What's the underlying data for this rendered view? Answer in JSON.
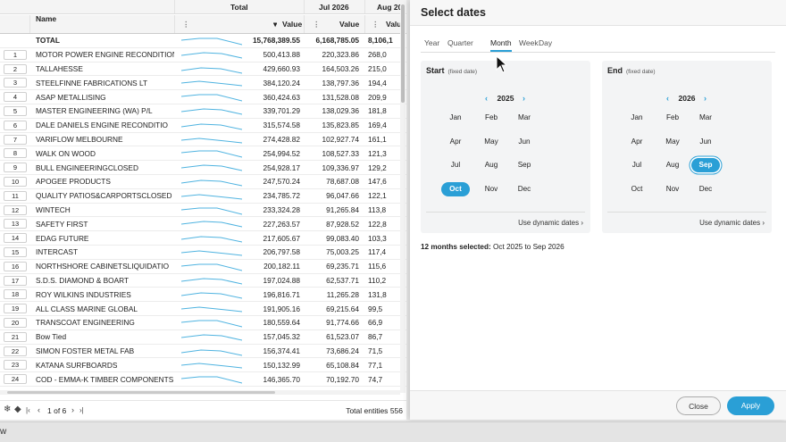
{
  "grid": {
    "group_headers": {
      "total": "Total",
      "jul": "Jul 2026",
      "aug": "Aug 20"
    },
    "name_header": "Name",
    "value_header": "Value",
    "total_row": {
      "name": "TOTAL",
      "total": "15,768,389.55",
      "jul": "6,168,785.05",
      "aug": "8,106,1"
    },
    "rows": [
      {
        "idx": "1",
        "name": "MOTOR POWER ENGINE RECONDITION",
        "total": "500,413.88",
        "jul": "220,323.86",
        "aug": "268,0"
      },
      {
        "idx": "2",
        "name": "TALLAHESSE",
        "total": "429,660.93",
        "jul": "164,503.26",
        "aug": "215,0"
      },
      {
        "idx": "3",
        "name": "STEELFINNE FABRICATIONS LT",
        "total": "384,120.24",
        "jul": "138,797.36",
        "aug": "194,4"
      },
      {
        "idx": "4",
        "name": "ASAP METALLISING",
        "total": "360,424.63",
        "jul": "131,528.08",
        "aug": "209,9"
      },
      {
        "idx": "5",
        "name": "MASTER ENGINEERING (WA) P/L",
        "total": "339,701.29",
        "jul": "138,029.36",
        "aug": "181,8"
      },
      {
        "idx": "6",
        "name": "DALE DANIELS ENGINE RECONDITIO",
        "total": "315,574.58",
        "jul": "135,823.85",
        "aug": "169,4"
      },
      {
        "idx": "7",
        "name": "VARIFLOW MELBOURNE",
        "total": "274,428.82",
        "jul": "102,927.74",
        "aug": "161,1"
      },
      {
        "idx": "8",
        "name": "WALK ON WOOD",
        "total": "254,994.52",
        "jul": "108,527.33",
        "aug": "121,3"
      },
      {
        "idx": "9",
        "name": "BULL ENGINEERINGCLOSED",
        "total": "254,928.17",
        "jul": "109,336.97",
        "aug": "129,2"
      },
      {
        "idx": "10",
        "name": "APOGEE PRODUCTS",
        "total": "247,570.24",
        "jul": "78,687.08",
        "aug": "147,6"
      },
      {
        "idx": "11",
        "name": "QUALITY PATIOS&CARPORTSCLOSED",
        "total": "234,785.72",
        "jul": "96,047.66",
        "aug": "122,1"
      },
      {
        "idx": "12",
        "name": "WINTECH",
        "total": "233,324.28",
        "jul": "91,265.84",
        "aug": "113,8"
      },
      {
        "idx": "13",
        "name": "SAFETY FIRST",
        "total": "227,263.57",
        "jul": "87,928.52",
        "aug": "122,8"
      },
      {
        "idx": "14",
        "name": "EDAG FUTURE",
        "total": "217,605.67",
        "jul": "99,083.40",
        "aug": "103,3"
      },
      {
        "idx": "15",
        "name": "INTERCAST",
        "total": "206,797.58",
        "jul": "75,003.25",
        "aug": "117,4"
      },
      {
        "idx": "16",
        "name": "NORTHSHORE CABINETSLIQUIDATIO",
        "total": "200,182.11",
        "jul": "69,235.71",
        "aug": "115,6"
      },
      {
        "idx": "17",
        "name": "S.D.S. DIAMOND & BOART",
        "total": "197,024.88",
        "jul": "62,537.71",
        "aug": "110,2"
      },
      {
        "idx": "18",
        "name": "ROY WILKINS INDUSTRIES",
        "total": "196,816.71",
        "jul": "11,265.28",
        "aug": "131,8"
      },
      {
        "idx": "19",
        "name": "ALL CLASS MARINE GLOBAL",
        "total": "191,905.16",
        "jul": "69,215.64",
        "aug": "99,5"
      },
      {
        "idx": "20",
        "name": "TRANSCOAT ENGINEERING",
        "total": "180,559.64",
        "jul": "91,774.66",
        "aug": "66,9"
      },
      {
        "idx": "21",
        "name": "Bow Tied",
        "total": "157,045.32",
        "jul": "61,523.07",
        "aug": "86,7"
      },
      {
        "idx": "22",
        "name": "SIMON FOSTER METAL FAB",
        "total": "156,374.41",
        "jul": "73,686.24",
        "aug": "71,5"
      },
      {
        "idx": "23",
        "name": "KATANA SURFBOARDS",
        "total": "150,132.99",
        "jul": "65,108.84",
        "aug": "77,1"
      },
      {
        "idx": "24",
        "name": "COD - EMMA-K TIMBER COMPONENTS",
        "total": "146,365.70",
        "jul": "70,192.70",
        "aug": "74,7"
      }
    ],
    "footer": {
      "page": "1 of 6",
      "total_label": "Total entities",
      "total_count": "556"
    }
  },
  "dialog": {
    "title": "Select dates",
    "tabs": [
      "Year",
      "Quarter",
      "Month",
      "Week",
      "Day"
    ],
    "active_tab": "Month",
    "start": {
      "title": "Start",
      "subtitle": "(fixed date)",
      "year": "2025",
      "months": [
        "Jan",
        "Feb",
        "Mar",
        "Apr",
        "May",
        "Jun",
        "Jul",
        "Aug",
        "Sep",
        "Oct",
        "Nov",
        "Dec"
      ],
      "selected": "Oct",
      "dynamic_label": "Use dynamic dates"
    },
    "end": {
      "title": "End",
      "subtitle": "(fixed date)",
      "year": "2026",
      "months": [
        "Jan",
        "Feb",
        "Mar",
        "Apr",
        "May",
        "Jun",
        "Jul",
        "Aug",
        "Sep",
        "Oct",
        "Nov",
        "Dec"
      ],
      "selected": "Sep",
      "dynamic_label": "Use dynamic dates"
    },
    "summary_bold": "12 months selected:",
    "summary_rest": " Oct 2025 to Sep 2026",
    "close_label": "Close",
    "apply_label": "Apply",
    "accent": "#2a9fd6"
  },
  "bottom_bar": {
    "text": "w"
  }
}
